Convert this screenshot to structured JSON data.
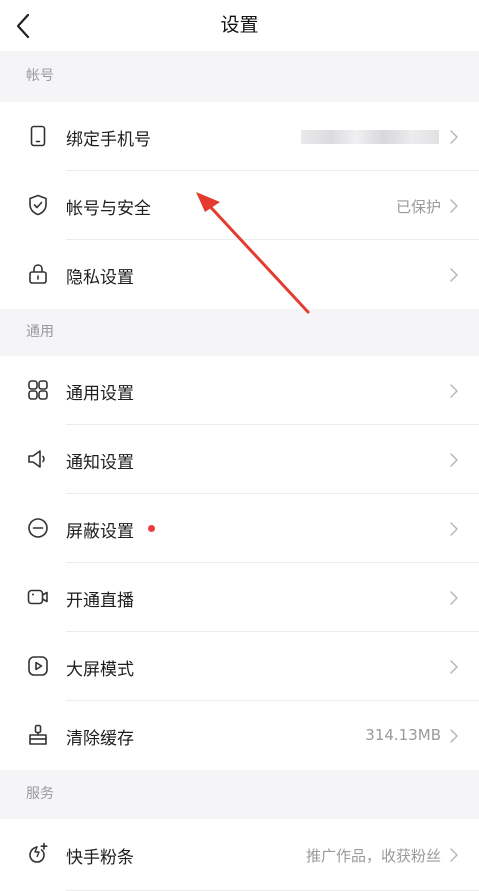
{
  "header": {
    "title": "设置"
  },
  "sections": {
    "account": {
      "label": "帐号"
    },
    "general": {
      "label": "通用"
    },
    "services": {
      "label": "服务"
    }
  },
  "rows": {
    "bind_phone": {
      "label": "绑定手机号",
      "icon": "phone-icon"
    },
    "account_security": {
      "label": "帐号与安全",
      "value": "已保护",
      "icon": "shield-check-icon"
    },
    "privacy": {
      "label": "隐私设置",
      "icon": "lock-icon"
    },
    "general_settings": {
      "label": "通用设置",
      "icon": "grid-icon"
    },
    "notifications": {
      "label": "通知设置",
      "icon": "speaker-icon"
    },
    "block_settings": {
      "label": "屏蔽设置",
      "icon": "minus-circle-icon"
    },
    "start_live": {
      "label": "开通直播",
      "icon": "video-icon"
    },
    "big_screen": {
      "label": "大屏模式",
      "icon": "play-icon"
    },
    "clear_cache": {
      "label": "清除缓存",
      "value": "314.13MB",
      "icon": "broom-icon"
    },
    "fans_boost": {
      "label": "快手粉条",
      "value": "推广作品，收获粉丝",
      "icon": "rocket-plus-icon"
    }
  },
  "colors": {
    "accent_red": "#ee3b3b",
    "annotation_arrow": "#e53a2e",
    "background": "#f5f5f7"
  }
}
